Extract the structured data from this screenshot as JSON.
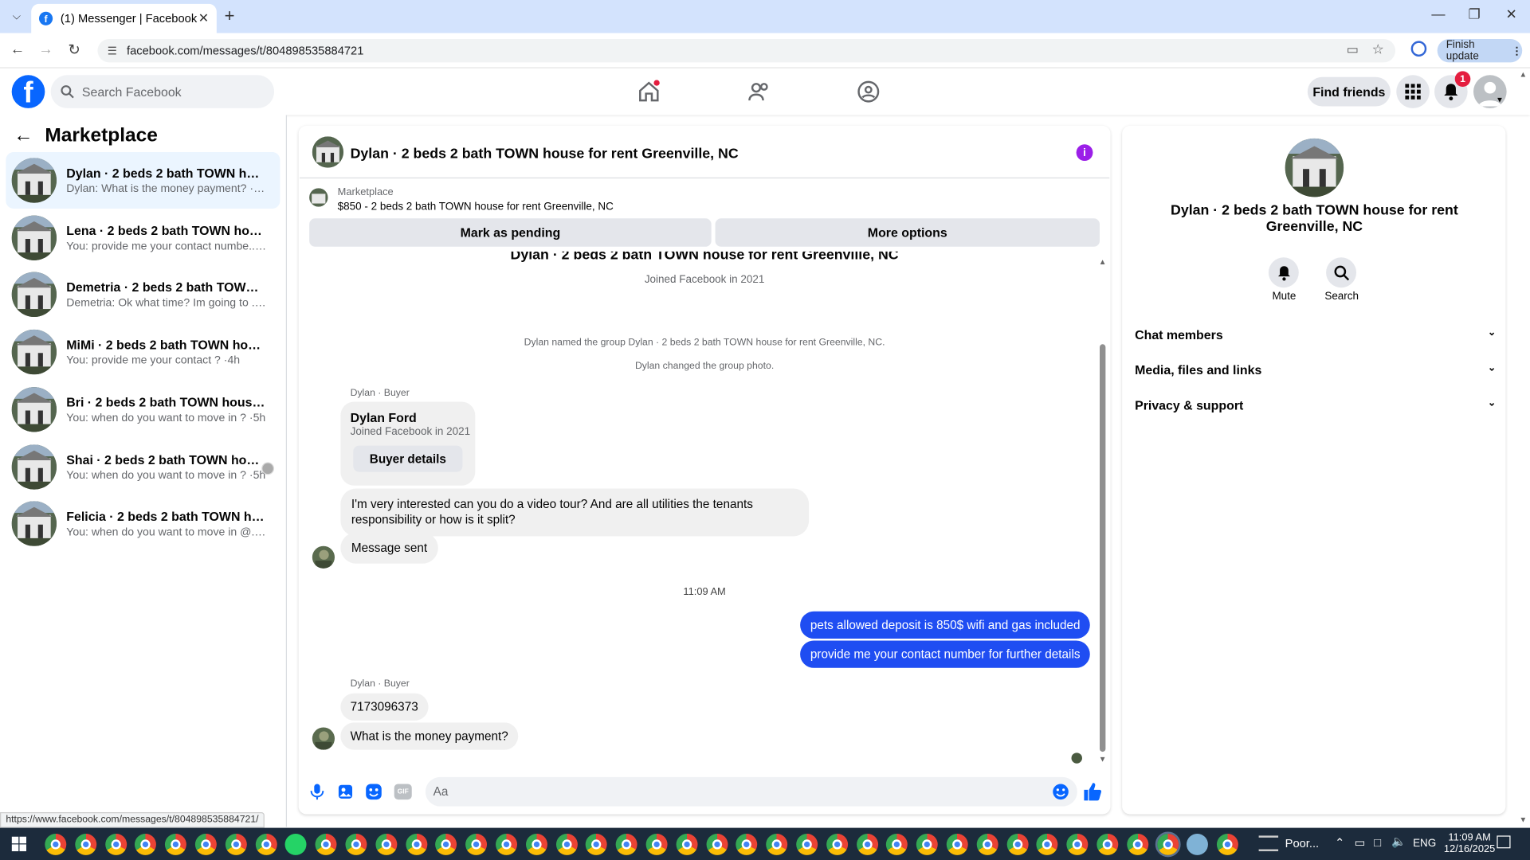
{
  "browser": {
    "tab_title": "(1) Messenger | Facebook",
    "url": "facebook.com/messages/t/804898535884721",
    "finish_update_label": "Finish update",
    "status_url": "https://www.facebook.com/messages/t/804898535884721/"
  },
  "fb_header": {
    "search_placeholder": "Search Facebook",
    "find_friends_label": "Find friends",
    "notification_count": "1"
  },
  "left_panel": {
    "title": "Marketplace",
    "conversations": [
      {
        "name": "Dylan · 2 beds 2 bath TOWN hous...",
        "preview": "Dylan: What is the money payment? ·1m",
        "active": true
      },
      {
        "name": "Lena · 2 beds 2 bath TOWN house ...",
        "preview": "You: provide me your contact numbe... ·1m",
        "active": false
      },
      {
        "name": "Demetria · 2 beds 2 bath TOWN h...",
        "preview": "Demetria: Ok what time? Im going to ... ·3h",
        "active": false
      },
      {
        "name": "MiMi · 2 beds 2 bath TOWN house...",
        "preview": "You: provide me your contact ? ·4h",
        "active": false
      },
      {
        "name": "Bri · 2 beds 2 bath TOWN house fo...",
        "preview": "You: when do you want to move in ? ·5h",
        "active": false
      },
      {
        "name": "Shai · 2 beds 2 bath TOWN hous...",
        "preview": "You: when do you want to move in ? ·5h",
        "active": false
      },
      {
        "name": "Felicia · 2 beds 2 bath TOWN hous...",
        "preview": "You: when do you want to move in @... ·5h",
        "active": false
      }
    ]
  },
  "chat": {
    "title": "Dylan · 2 beds 2 bath TOWN house for rent Greenville, NC",
    "marketplace_label": "Marketplace",
    "listing": "$850 - 2 beds 2 bath TOWN house for rent Greenville, NC",
    "mark_pending_label": "Mark as pending",
    "more_options_label": "More options",
    "top_title": "Dylan · 2 beds 2 bath TOWN house for rent Greenville, NC",
    "joined": "Joined Facebook in 2021",
    "sys_named": "Dylan named the group Dylan · 2 beds 2 bath TOWN house for rent Greenville, NC.",
    "sys_photo": "Dylan changed the group photo.",
    "sender_label": "Dylan · Buyer",
    "card_name": "Dylan Ford",
    "card_joined": "Joined Facebook in 2021",
    "buyer_details_label": "Buyer details",
    "msg1": "I'm very interested can you do a video tour? And are all utilities the tenants responsibility or how is it split?",
    "msg2": "Message sent",
    "time_divider": "11:09 AM",
    "mine1": "pets allowed deposit is 850$ wifi and gas included",
    "mine2": "provide me your contact number for further details",
    "sender_label2": "Dylan · Buyer",
    "msg3": "7173096373",
    "msg4": "What is the money payment?",
    "composer_placeholder": "Aa"
  },
  "right_panel": {
    "title": "Dylan · 2 beds 2 bath TOWN house for rent Greenville, NC",
    "mute_label": "Mute",
    "search_label": "Search",
    "sections": [
      "Chat members",
      "Media, files and links",
      "Privacy & support"
    ]
  },
  "taskbar": {
    "weather": "Poor...",
    "lang": "ENG",
    "time": "11:09 AM",
    "date": "12/16/2025"
  },
  "colors": {
    "fb_blue": "#0866ff",
    "my_bubble": "#1f4df2",
    "info_purple": "#9b1fe8",
    "badge_red": "#e41e3f"
  }
}
